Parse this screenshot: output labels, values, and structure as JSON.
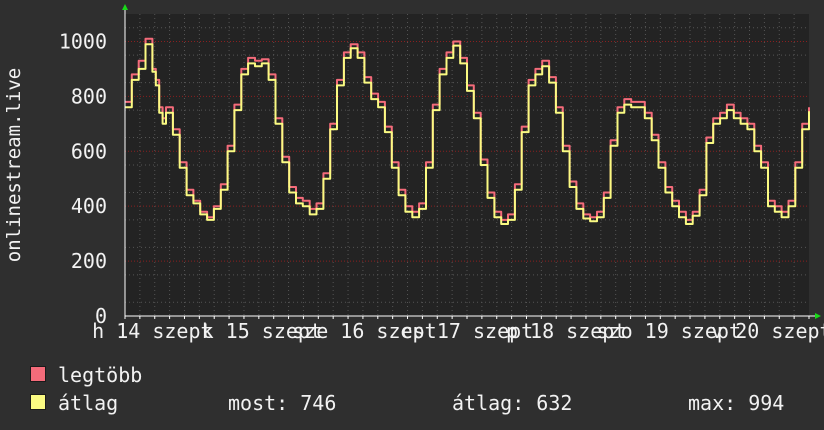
{
  "chart_data": {
    "type": "line",
    "ylabel": "onlinestream.live",
    "ylim": [
      0,
      1100
    ],
    "yticks": [
      0,
      200,
      400,
      600,
      800,
      1000
    ],
    "grid": true,
    "xlim": [
      0,
      1
    ],
    "x_tick_labels": [
      {
        "text": "h 14 szept",
        "x": 0.04
      },
      {
        "text": "k 15 szept",
        "x": 0.2
      },
      {
        "text": "sze 16 szept",
        "x": 0.35
      },
      {
        "text": "cs 17 szept",
        "x": 0.5
      },
      {
        "text": "p 18 szept",
        "x": 0.645
      },
      {
        "text": "szo 19 szept",
        "x": 0.795
      },
      {
        "text": "v 20 szept",
        "x": 0.945
      }
    ],
    "series": [
      {
        "name": "legtöbb",
        "color": "#f46b7a",
        "x": [
          0,
          0.01,
          0.02,
          0.03,
          0.04,
          0.045,
          0.05,
          0.055,
          0.06,
          0.07,
          0.08,
          0.09,
          0.1,
          0.11,
          0.12,
          0.13,
          0.14,
          0.15,
          0.16,
          0.17,
          0.18,
          0.19,
          0.2,
          0.21,
          0.22,
          0.23,
          0.24,
          0.25,
          0.26,
          0.27,
          0.28,
          0.29,
          0.3,
          0.31,
          0.32,
          0.33,
          0.34,
          0.35,
          0.36,
          0.37,
          0.38,
          0.39,
          0.4,
          0.41,
          0.42,
          0.43,
          0.44,
          0.45,
          0.46,
          0.47,
          0.48,
          0.49,
          0.5,
          0.51,
          0.52,
          0.53,
          0.54,
          0.55,
          0.56,
          0.57,
          0.58,
          0.59,
          0.6,
          0.61,
          0.62,
          0.63,
          0.64,
          0.65,
          0.66,
          0.67,
          0.68,
          0.69,
          0.7,
          0.71,
          0.72,
          0.73,
          0.74,
          0.75,
          0.76,
          0.77,
          0.78,
          0.79,
          0.8,
          0.81,
          0.82,
          0.83,
          0.84,
          0.85,
          0.86,
          0.87,
          0.88,
          0.89,
          0.9,
          0.91,
          0.92,
          0.93,
          0.94,
          0.95,
          0.96,
          0.97,
          0.98,
          0.99,
          1.0
        ],
        "values": [
          780,
          880,
          930,
          1010,
          900,
          860,
          760,
          720,
          760,
          680,
          560,
          460,
          420,
          380,
          360,
          400,
          480,
          620,
          770,
          900,
          940,
          930,
          935,
          880,
          720,
          580,
          470,
          430,
          420,
          390,
          410,
          520,
          700,
          860,
          960,
          990,
          960,
          870,
          810,
          780,
          690,
          560,
          460,
          400,
          380,
          410,
          560,
          770,
          900,
          960,
          1000,
          940,
          840,
          740,
          570,
          450,
          380,
          350,
          370,
          480,
          690,
          860,
          900,
          930,
          870,
          760,
          620,
          490,
          410,
          370,
          360,
          380,
          450,
          640,
          760,
          790,
          780,
          780,
          740,
          660,
          560,
          470,
          420,
          380,
          350,
          380,
          460,
          650,
          720,
          740,
          770,
          740,
          720,
          700,
          620,
          560,
          420,
          400,
          380,
          420,
          560,
          700,
          760
        ]
      },
      {
        "name": "átlag",
        "color": "#fafa82",
        "x": [
          0,
          0.01,
          0.02,
          0.03,
          0.04,
          0.045,
          0.05,
          0.055,
          0.06,
          0.07,
          0.08,
          0.09,
          0.1,
          0.11,
          0.12,
          0.13,
          0.14,
          0.15,
          0.16,
          0.17,
          0.18,
          0.19,
          0.2,
          0.21,
          0.22,
          0.23,
          0.24,
          0.25,
          0.26,
          0.27,
          0.28,
          0.29,
          0.3,
          0.31,
          0.32,
          0.33,
          0.34,
          0.35,
          0.36,
          0.37,
          0.38,
          0.39,
          0.4,
          0.41,
          0.42,
          0.43,
          0.44,
          0.45,
          0.46,
          0.47,
          0.48,
          0.49,
          0.5,
          0.51,
          0.52,
          0.53,
          0.54,
          0.55,
          0.56,
          0.57,
          0.58,
          0.59,
          0.6,
          0.61,
          0.62,
          0.63,
          0.64,
          0.65,
          0.66,
          0.67,
          0.68,
          0.69,
          0.7,
          0.71,
          0.72,
          0.73,
          0.74,
          0.75,
          0.76,
          0.77,
          0.78,
          0.79,
          0.8,
          0.81,
          0.82,
          0.83,
          0.84,
          0.85,
          0.86,
          0.87,
          0.88,
          0.89,
          0.9,
          0.91,
          0.92,
          0.93,
          0.94,
          0.95,
          0.96,
          0.97,
          0.98,
          0.99,
          1.0
        ],
        "values": [
          760,
          860,
          900,
          990,
          890,
          840,
          740,
          700,
          740,
          660,
          540,
          440,
          410,
          370,
          350,
          390,
          460,
          600,
          750,
          880,
          920,
          910,
          920,
          860,
          700,
          560,
          450,
          410,
          400,
          370,
          390,
          500,
          680,
          840,
          940,
          975,
          940,
          850,
          790,
          760,
          670,
          540,
          440,
          380,
          360,
          390,
          540,
          750,
          880,
          940,
          985,
          920,
          820,
          720,
          550,
          430,
          360,
          335,
          350,
          460,
          670,
          840,
          880,
          910,
          850,
          740,
          600,
          470,
          390,
          355,
          345,
          360,
          430,
          620,
          740,
          770,
          760,
          760,
          720,
          640,
          540,
          450,
          400,
          360,
          335,
          365,
          440,
          630,
          700,
          720,
          750,
          720,
          700,
          680,
          600,
          540,
          400,
          380,
          360,
          400,
          540,
          680,
          746
        ]
      }
    ],
    "stats": {
      "most": "most: 746",
      "atlag": "átlag: 632",
      "max": "max: 994"
    }
  },
  "colors": {
    "background": "#2f2f2f",
    "plot_background": "#232323",
    "grid_major": "#8a1f1f",
    "grid_minor": "#555555",
    "axis": "#ffffff",
    "arrow": "#19d919"
  }
}
